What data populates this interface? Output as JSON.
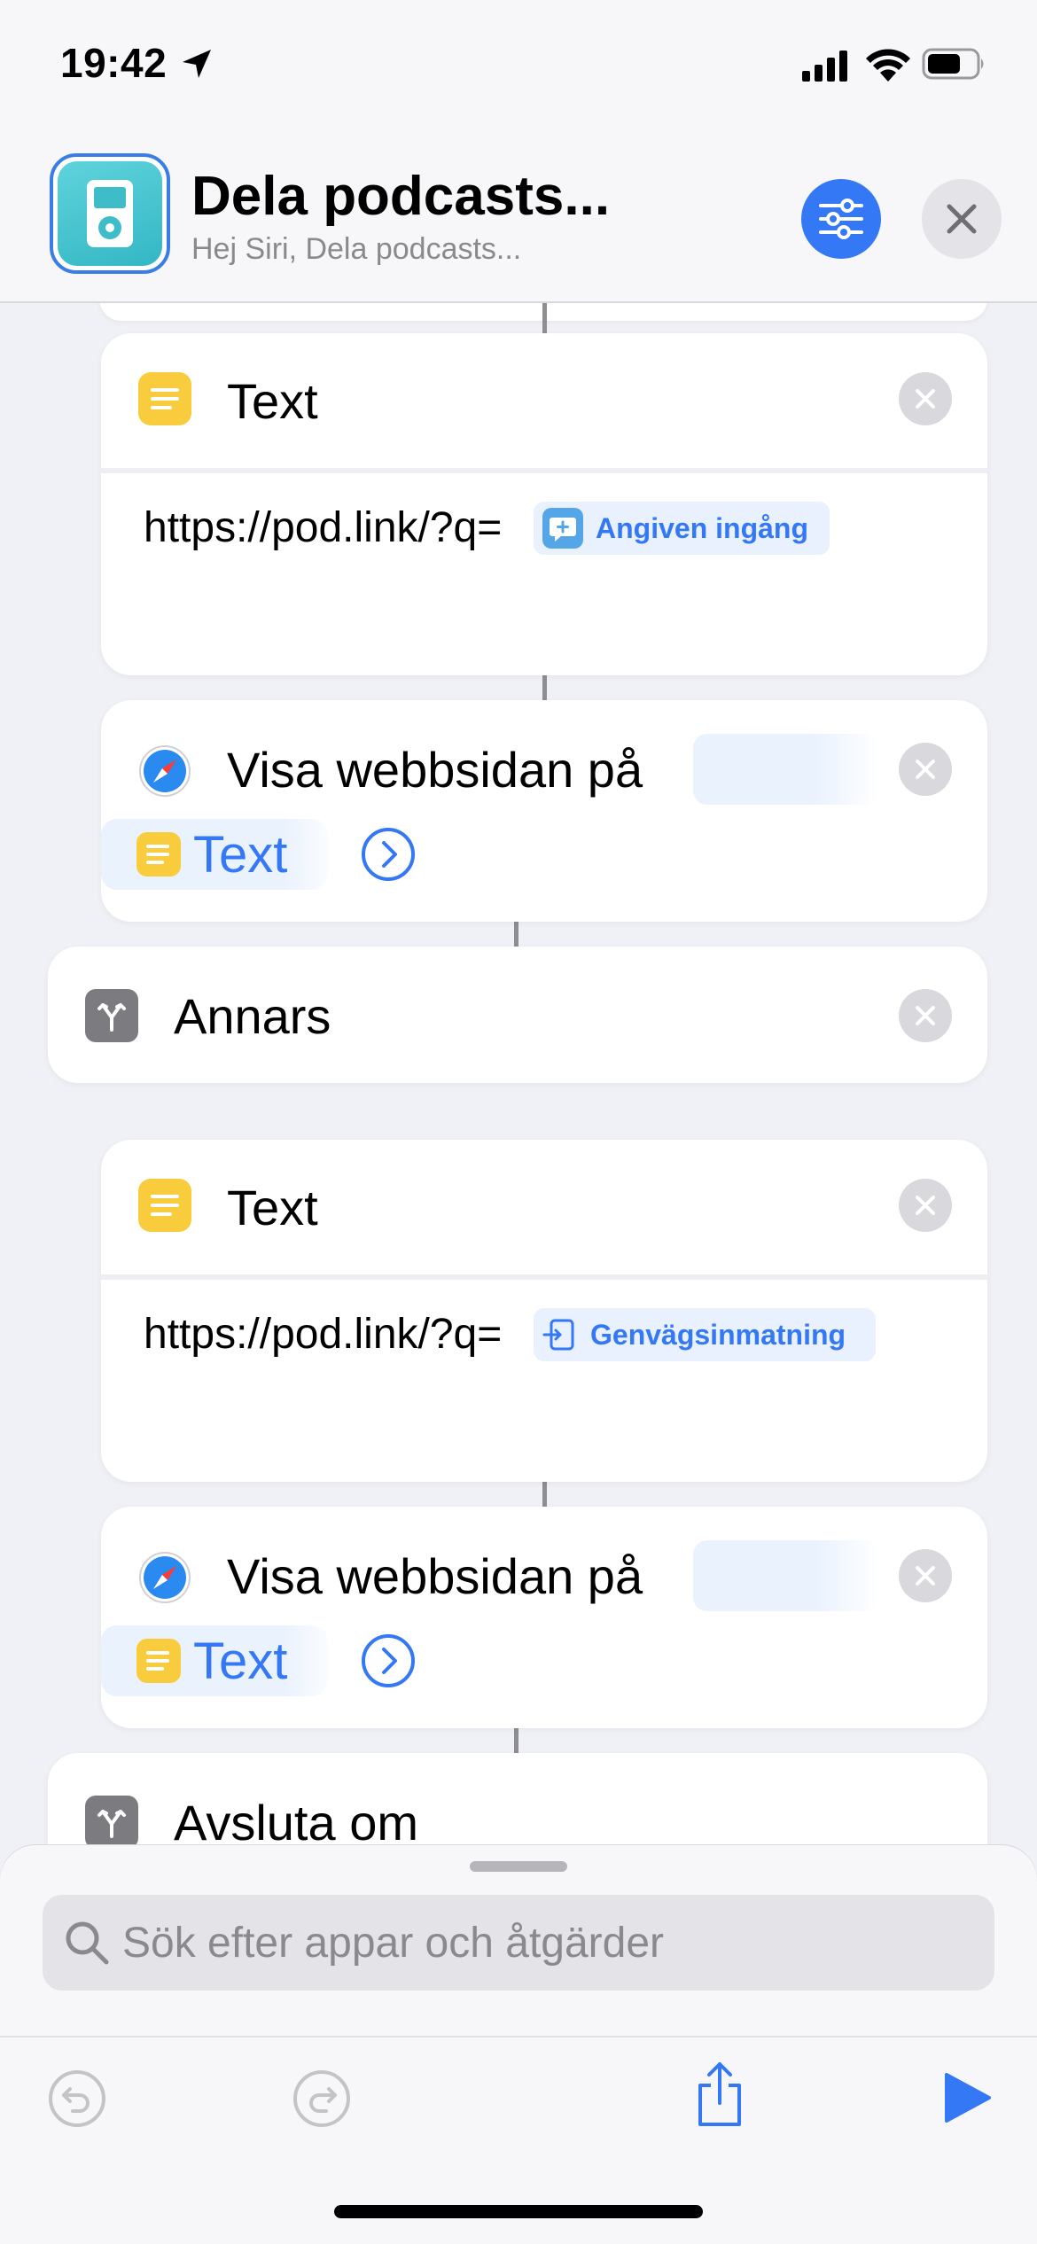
{
  "status_bar": {
    "time": "19:42",
    "icons": [
      "location-arrow-icon",
      "cellular-signal-icon",
      "wifi-icon",
      "battery-icon"
    ]
  },
  "header": {
    "title": "Dela podcasts...",
    "subtitle": "Hej Siri, Dela podcasts...",
    "app_icon": "ipod-icon",
    "settings_icon": "sliders-icon",
    "close_icon": "close-icon",
    "accent_color": "#3478f6"
  },
  "actions": [
    {
      "type": "text",
      "title": "Text",
      "url_prefix": "https://pod.link/?q=",
      "token_label": "Angiven ingång",
      "token_icon": "input-bubble-icon"
    },
    {
      "type": "show_webpage",
      "title": "Visa webbsidan på",
      "variable_label": "Text",
      "icon": "safari-icon"
    },
    {
      "type": "otherwise",
      "title": "Annars",
      "icon": "branch-icon"
    },
    {
      "type": "text",
      "title": "Text",
      "url_prefix": "https://pod.link/?q=",
      "token_label": "Genvägsinmatning",
      "token_icon": "shortcut-input-icon"
    },
    {
      "type": "show_webpage",
      "title": "Visa webbsidan på",
      "variable_label": "Text",
      "icon": "safari-icon"
    },
    {
      "type": "end_if",
      "title": "Avsluta om",
      "icon": "branch-icon"
    }
  ],
  "search": {
    "placeholder": "Sök efter appar och åtgärder",
    "value": ""
  },
  "toolbar": {
    "buttons": [
      "undo-icon",
      "redo-icon",
      "share-icon",
      "play-icon"
    ]
  },
  "colors": {
    "text_action_yellow": "#f8cc3d",
    "token_blue": "#3478f6",
    "background": "#f0f1f6"
  }
}
